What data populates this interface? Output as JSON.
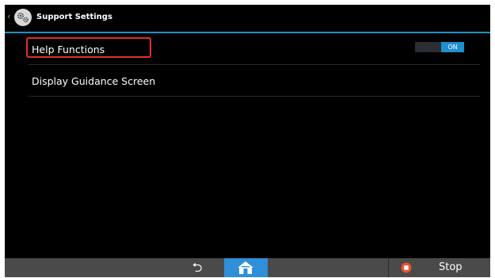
{
  "header": {
    "back_icon": "chevron-left-icon",
    "settings_icon": "gear-icon",
    "title": "Support Settings"
  },
  "settings": {
    "items": [
      {
        "label": "Help Functions",
        "toggle": "ON"
      },
      {
        "label": "Display Guidance Screen"
      }
    ]
  },
  "bottom_bar": {
    "back_icon": "back-arrow-icon",
    "home_icon": "home-icon",
    "stop_icon": "stop-icon",
    "stop_label": "Stop"
  },
  "colors": {
    "accent": "#1f8fcf",
    "home_button": "#2f8fd8",
    "highlight": "#e0302a",
    "bar": "#4a4a4a"
  }
}
